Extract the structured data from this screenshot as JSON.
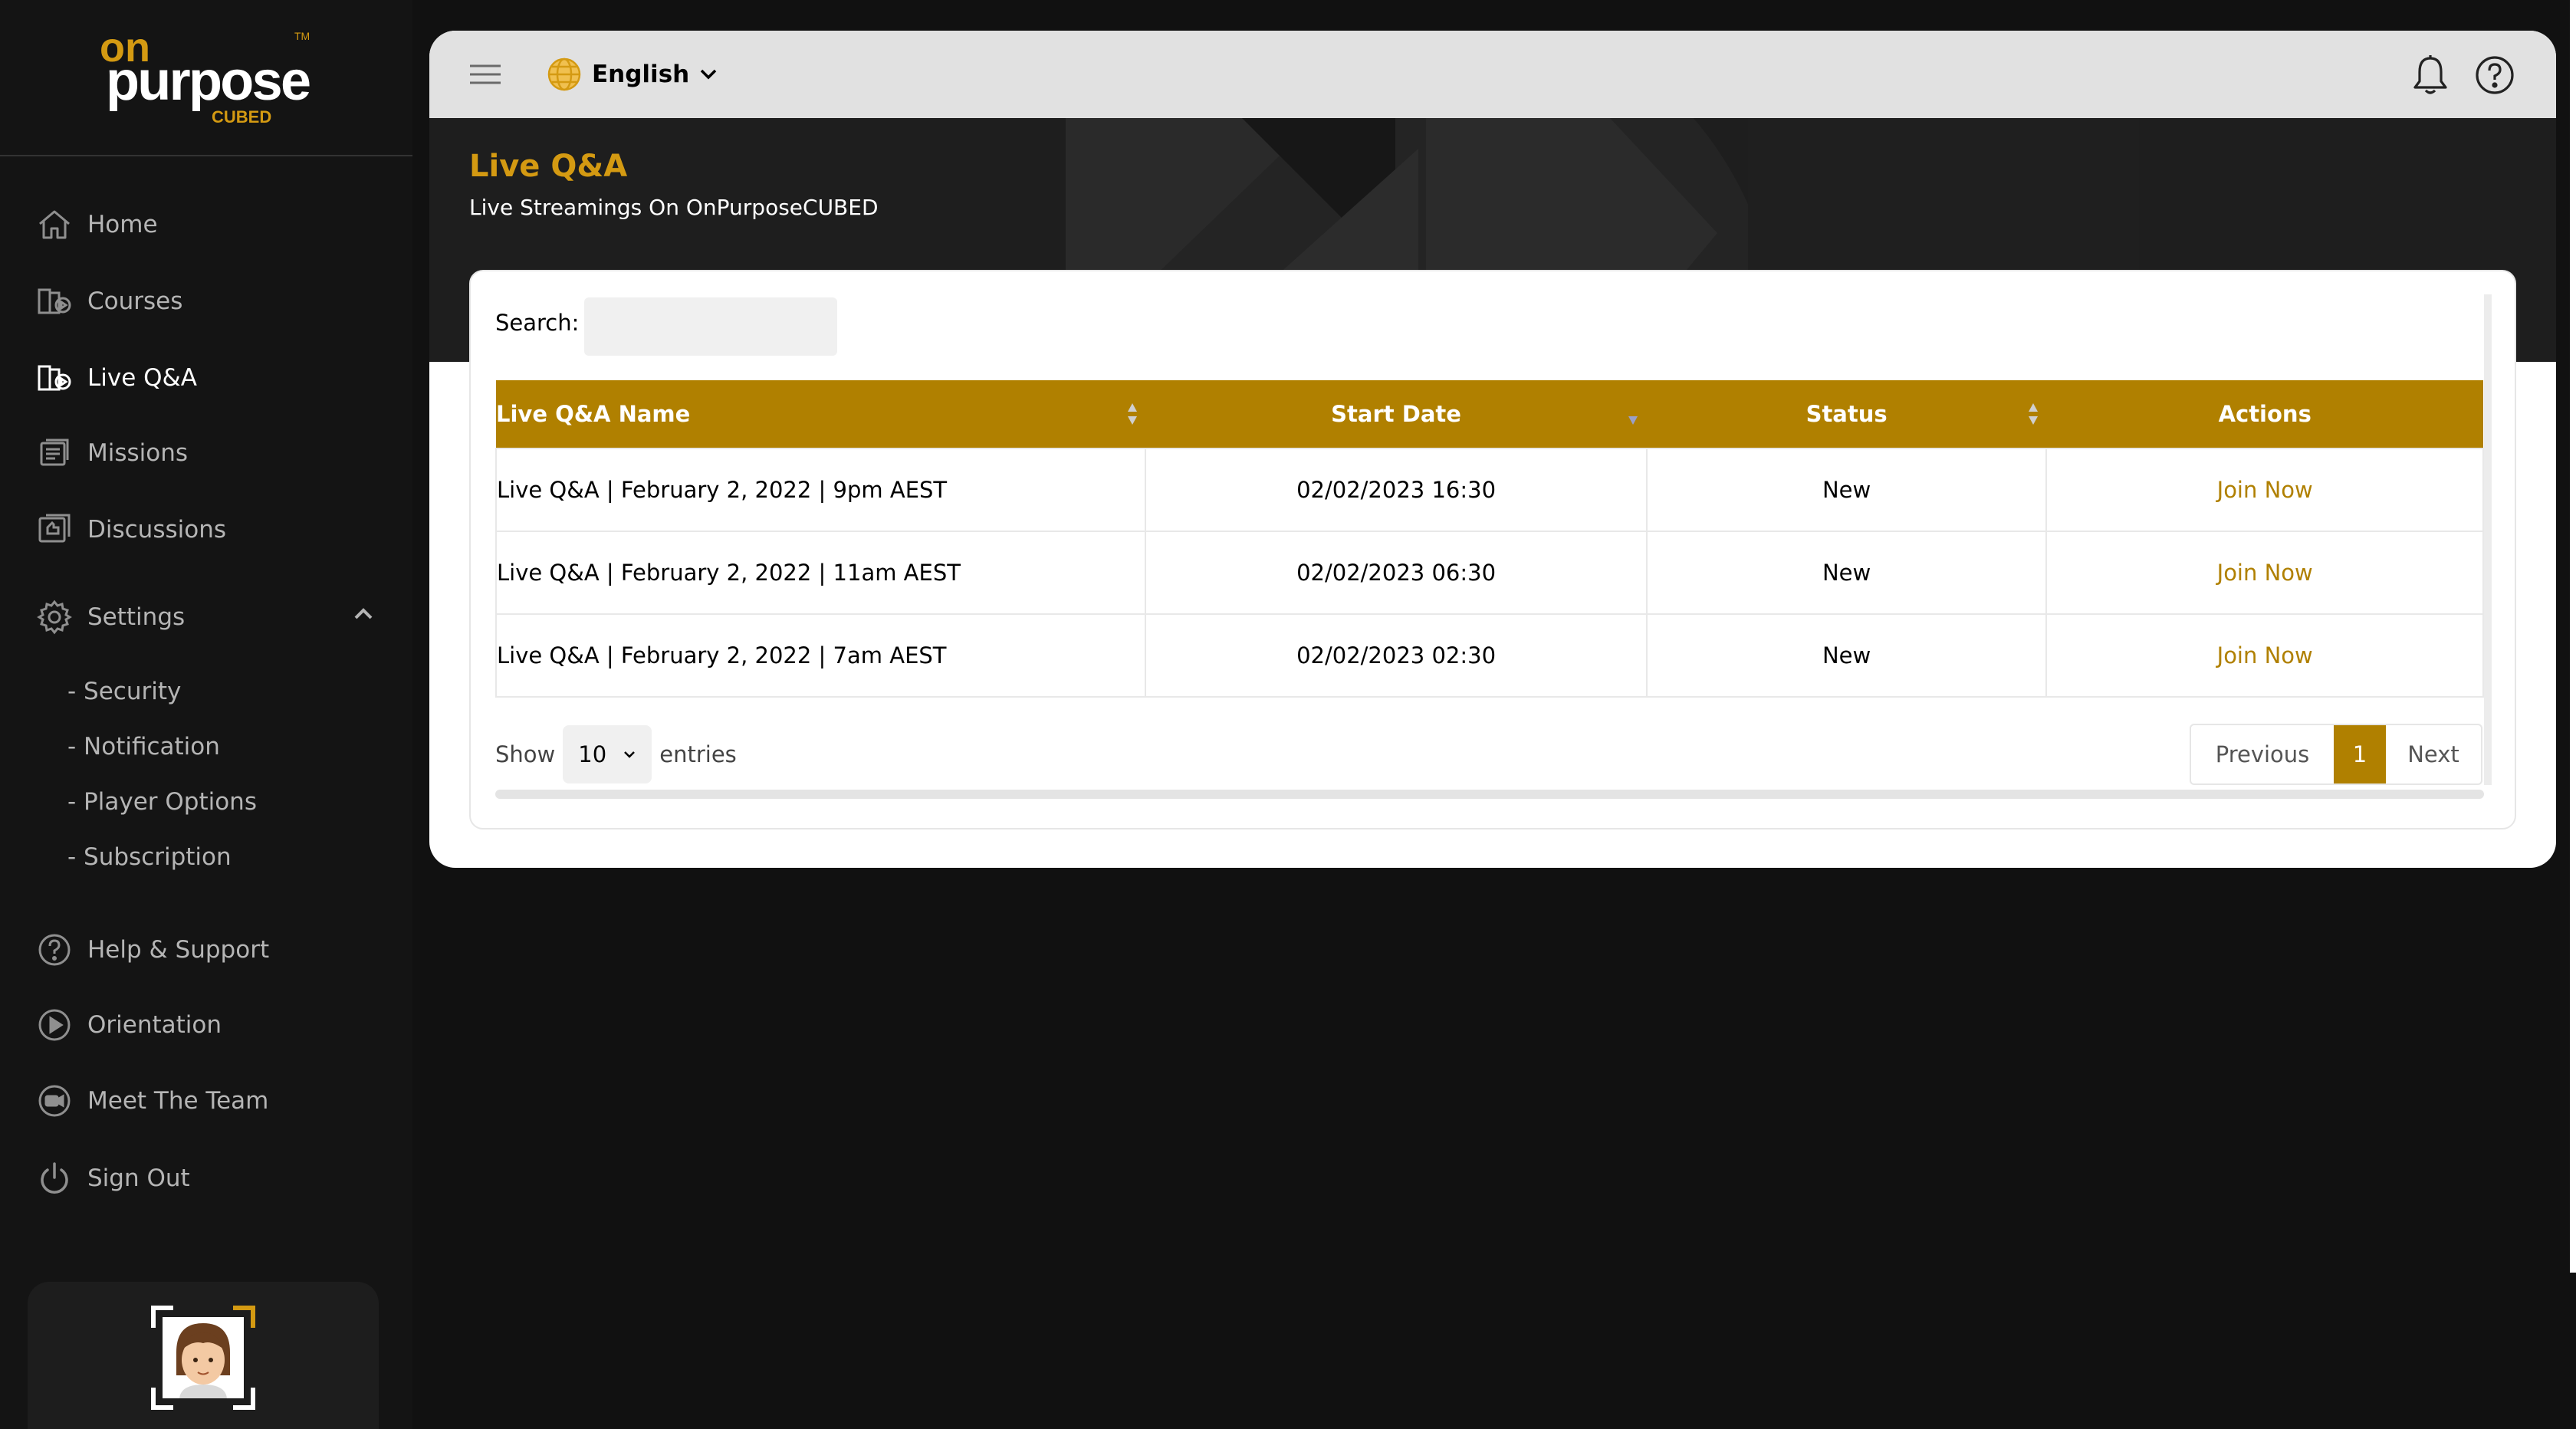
{
  "brand": {
    "logo_text": "onpurpose CUBED TM"
  },
  "sidebar": {
    "items": [
      {
        "label": "Home",
        "icon": "home-icon"
      },
      {
        "label": "Courses",
        "icon": "courses-icon"
      },
      {
        "label": "Live Q&A",
        "icon": "live-qa-icon",
        "active": true
      },
      {
        "label": "Missions",
        "icon": "missions-icon"
      },
      {
        "label": "Discussions",
        "icon": "discussions-icon"
      },
      {
        "label": "Settings",
        "icon": "gear-icon",
        "expanded": true
      },
      {
        "label": "Help & Support",
        "icon": "help-circle-icon"
      },
      {
        "label": "Orientation",
        "icon": "play-circle-icon"
      },
      {
        "label": "Meet The Team",
        "icon": "video-camera-icon"
      },
      {
        "label": "Sign Out",
        "icon": "power-icon"
      }
    ],
    "settings_sub": [
      "- Security",
      "- Notification",
      "- Player Options",
      "- Subscription"
    ]
  },
  "topbar": {
    "language": "English"
  },
  "page": {
    "title": "Live Q&A",
    "subtitle": "Live Streamings On OnPurposeCUBED"
  },
  "search": {
    "label": "Search:",
    "value": ""
  },
  "table": {
    "columns": [
      "Live Q&A Name",
      "Start Date",
      "Status",
      "Actions"
    ],
    "rows": [
      {
        "name": "Live Q&A | February 2, 2022 | 9pm AEST",
        "start": "02/02/2023 16:30",
        "status": "New",
        "action": "Join Now"
      },
      {
        "name": "Live Q&A | February 2, 2022 | 11am AEST",
        "start": "02/02/2023 06:30",
        "status": "New",
        "action": "Join Now"
      },
      {
        "name": "Live Q&A | February 2, 2022 | 7am AEST",
        "start": "02/02/2023 02:30",
        "status": "New",
        "action": "Join Now"
      }
    ]
  },
  "footer": {
    "show_label": "Show",
    "entries_value": "10",
    "entries_label": "entries",
    "prev": "Previous",
    "page": "1",
    "next": "Next"
  },
  "colors": {
    "accent": "#b08000",
    "title": "#d49a12",
    "sidebar_bg": "#141414"
  }
}
